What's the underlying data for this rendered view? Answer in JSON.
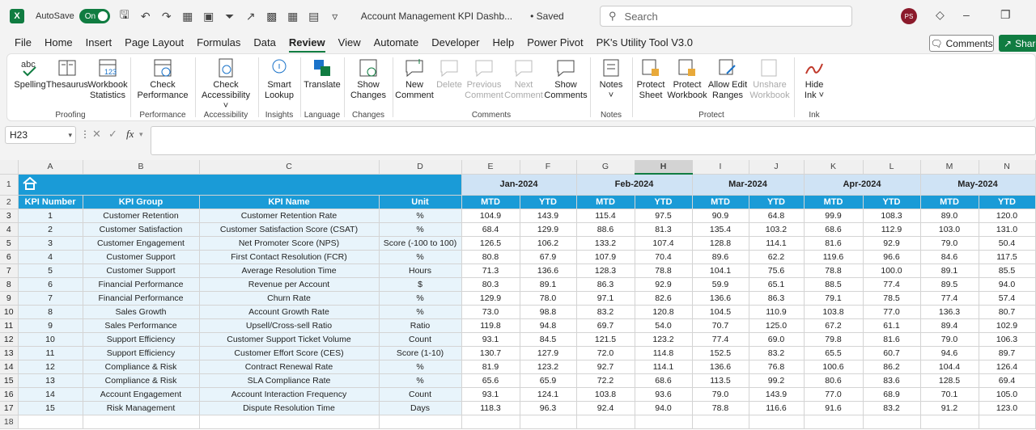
{
  "titlebar": {
    "app_icon": "X",
    "autosave_label": "AutoSave",
    "toggle_label": "On",
    "doc_title": "Account Management KPI Dashb...",
    "saved_label": "• Saved",
    "search_placeholder": "Search",
    "avatar_initials": "PS"
  },
  "tabs": [
    {
      "label": "File"
    },
    {
      "label": "Home"
    },
    {
      "label": "Insert"
    },
    {
      "label": "Page Layout"
    },
    {
      "label": "Formulas"
    },
    {
      "label": "Data"
    },
    {
      "label": "Review"
    },
    {
      "label": "View"
    },
    {
      "label": "Automate"
    },
    {
      "label": "Developer"
    },
    {
      "label": "Help"
    },
    {
      "label": "Power Pivot"
    },
    {
      "label": "PK's Utility Tool V3.0"
    }
  ],
  "active_tab": "Review",
  "comments_button": "Comments",
  "share_button": "Share",
  "ribbon": {
    "buttons": [
      {
        "l1": "Spelling",
        "l2": ""
      },
      {
        "l1": "Thesaurus",
        "l2": ""
      },
      {
        "l1": "Workbook",
        "l2": "Statistics"
      },
      {
        "l1": "Check",
        "l2": "Performance"
      },
      {
        "l1": "Check",
        "l2": "Accessibility ˅"
      },
      {
        "l1": "Smart",
        "l2": "Lookup"
      },
      {
        "l1": "Translate",
        "l2": ""
      },
      {
        "l1": "Show",
        "l2": "Changes"
      },
      {
        "l1": "New",
        "l2": "Comment"
      },
      {
        "l1": "Delete",
        "l2": ""
      },
      {
        "l1": "Previous",
        "l2": "Comment"
      },
      {
        "l1": "Next",
        "l2": "Comment"
      },
      {
        "l1": "Show",
        "l2": "Comments"
      },
      {
        "l1": "Notes",
        "l2": "˅"
      },
      {
        "l1": "Protect",
        "l2": "Sheet"
      },
      {
        "l1": "Protect",
        "l2": "Workbook"
      },
      {
        "l1": "Allow Edit",
        "l2": "Ranges"
      },
      {
        "l1": "Unshare",
        "l2": "Workbook"
      },
      {
        "l1": "Hide",
        "l2": "Ink ˅"
      }
    ],
    "groups": [
      "Proofing",
      "Performance",
      "Accessibility",
      "Insights",
      "Language",
      "Changes",
      "Comments",
      "Notes",
      "Protect",
      "Ink"
    ]
  },
  "formula_bar": {
    "cell_ref": "H23",
    "fx": "fx",
    "content": ""
  },
  "sheet": {
    "columns": [
      "A",
      "B",
      "C",
      "D",
      "E",
      "F",
      "G",
      "H",
      "I",
      "J",
      "K",
      "L",
      "M",
      "N"
    ],
    "selected_column": "H",
    "row_numbers": [
      "1",
      "2",
      "3",
      "4",
      "5",
      "6",
      "7",
      "8",
      "9",
      "10",
      "11",
      "12",
      "13",
      "14",
      "15",
      "16",
      "17",
      "18"
    ],
    "months": [
      "Jan-2024",
      "Feb-2024",
      "Mar-2024",
      "Apr-2024",
      "May-2024"
    ],
    "headers": [
      "KPI Number",
      "KPI Group",
      "KPI Name",
      "Unit"
    ],
    "sub_headers": [
      "MTD",
      "YTD",
      "MTD",
      "YTD",
      "MTD",
      "YTD",
      "MTD",
      "YTD",
      "MTD",
      "YTD"
    ],
    "rows": [
      [
        "1",
        "Customer Retention",
        "Customer Retention Rate",
        "%",
        "104.9",
        "143.9",
        "115.4",
        "97.5",
        "90.9",
        "64.8",
        "99.9",
        "108.3",
        "89.0",
        "120.0"
      ],
      [
        "2",
        "Customer Satisfaction",
        "Customer Satisfaction Score (CSAT)",
        "%",
        "68.4",
        "129.9",
        "88.6",
        "81.3",
        "135.4",
        "103.2",
        "68.6",
        "112.9",
        "103.0",
        "131.0"
      ],
      [
        "3",
        "Customer Engagement",
        "Net Promoter Score (NPS)",
        "Score (-100 to 100)",
        "126.5",
        "106.2",
        "133.2",
        "107.4",
        "128.8",
        "114.1",
        "81.6",
        "92.9",
        "79.0",
        "50.4"
      ],
      [
        "4",
        "Customer Support",
        "First Contact Resolution (FCR)",
        "%",
        "80.8",
        "67.9",
        "107.9",
        "70.4",
        "89.6",
        "62.2",
        "119.6",
        "96.6",
        "84.6",
        "117.5"
      ],
      [
        "5",
        "Customer Support",
        "Average Resolution Time",
        "Hours",
        "71.3",
        "136.6",
        "128.3",
        "78.8",
        "104.1",
        "75.6",
        "78.8",
        "100.0",
        "89.1",
        "85.5"
      ],
      [
        "6",
        "Financial Performance",
        "Revenue per Account",
        "$",
        "80.3",
        "89.1",
        "86.3",
        "92.9",
        "59.9",
        "65.1",
        "88.5",
        "77.4",
        "89.5",
        "94.0"
      ],
      [
        "7",
        "Financial Performance",
        "Churn Rate",
        "%",
        "129.9",
        "78.0",
        "97.1",
        "82.6",
        "136.6",
        "86.3",
        "79.1",
        "78.5",
        "77.4",
        "57.4"
      ],
      [
        "8",
        "Sales Growth",
        "Account Growth Rate",
        "%",
        "73.0",
        "98.8",
        "83.2",
        "120.8",
        "104.5",
        "110.9",
        "103.8",
        "77.0",
        "136.3",
        "80.7"
      ],
      [
        "9",
        "Sales Performance",
        "Upsell/Cross-sell Ratio",
        "Ratio",
        "119.8",
        "94.8",
        "69.7",
        "54.0",
        "70.7",
        "125.0",
        "67.2",
        "61.1",
        "89.4",
        "102.9"
      ],
      [
        "10",
        "Support Efficiency",
        "Customer Support Ticket Volume",
        "Count",
        "93.1",
        "84.5",
        "121.5",
        "123.2",
        "77.4",
        "69.0",
        "79.8",
        "81.6",
        "79.0",
        "106.3"
      ],
      [
        "11",
        "Support Efficiency",
        "Customer Effort Score (CES)",
        "Score (1-10)",
        "130.7",
        "127.9",
        "72.0",
        "114.8",
        "152.5",
        "83.2",
        "65.5",
        "60.7",
        "94.6",
        "89.7"
      ],
      [
        "12",
        "Compliance & Risk",
        "Contract Renewal Rate",
        "%",
        "81.9",
        "123.2",
        "92.7",
        "114.1",
        "136.6",
        "76.8",
        "100.6",
        "86.2",
        "104.4",
        "126.4"
      ],
      [
        "13",
        "Compliance & Risk",
        "SLA Compliance Rate",
        "%",
        "65.6",
        "65.9",
        "72.2",
        "68.6",
        "113.5",
        "99.2",
        "80.6",
        "83.6",
        "128.5",
        "69.4"
      ],
      [
        "14",
        "Account Engagement",
        "Account Interaction Frequency",
        "Count",
        "93.1",
        "124.1",
        "103.8",
        "93.6",
        "79.0",
        "143.9",
        "77.0",
        "68.9",
        "70.1",
        "105.0"
      ],
      [
        "15",
        "Risk Management",
        "Dispute Resolution Time",
        "Days",
        "118.3",
        "96.3",
        "92.4",
        "94.0",
        "78.8",
        "116.6",
        "91.6",
        "83.2",
        "91.2",
        "123.0"
      ]
    ]
  },
  "colors": {
    "accent": "#107c41",
    "header_blue": "#1a9bd7",
    "month_band": "#cfe3f5",
    "cat_fill": "#e8f4fb"
  }
}
